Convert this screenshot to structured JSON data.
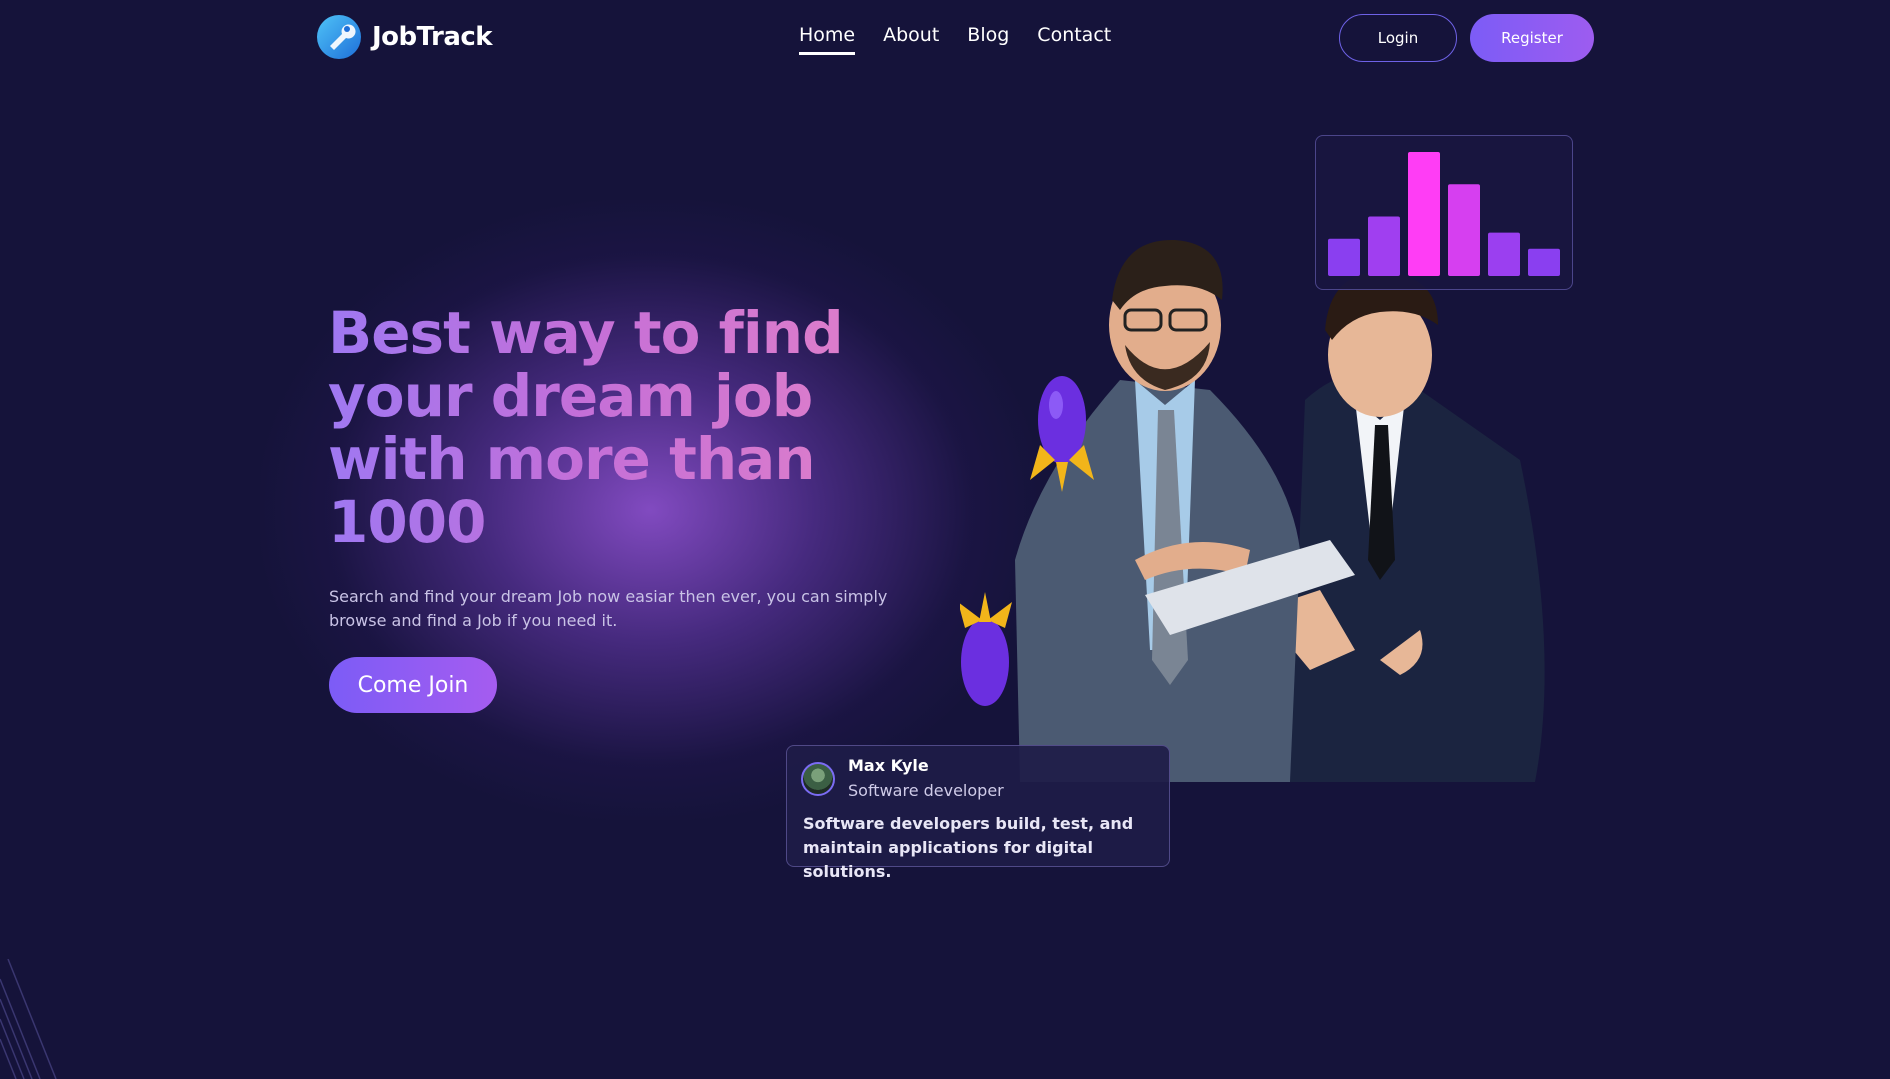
{
  "brand": {
    "name": "JobTrack",
    "icon": "wrench-logo-icon"
  },
  "nav": {
    "items": [
      {
        "label": "Home",
        "active": true
      },
      {
        "label": "About",
        "active": false
      },
      {
        "label": "Blog",
        "active": false
      },
      {
        "label": "Contact",
        "active": false
      }
    ]
  },
  "auth": {
    "login_label": "Login",
    "register_label": "Register"
  },
  "hero": {
    "title": "Best way to find your dream job with more than 1000",
    "subtitle": "Search and find your dream Job now easiar then ever, you can simply browse and find a Job if you need it.",
    "cta_label": "Come Join"
  },
  "stats_widget": {
    "bars": [
      0.3,
      0.48,
      1.0,
      0.74,
      0.35,
      0.22
    ],
    "colors": [
      "#8a3ff0",
      "#a03ff0",
      "#ff3df5",
      "#d63ff0",
      "#9b3ff0",
      "#8a3ff0"
    ]
  },
  "profile_card": {
    "name": "Max Kyle",
    "role": "Software developer",
    "description": "Software developers build, test, and maintain applications for digital solutions."
  },
  "colors": {
    "background": "#15133a",
    "accent": "#7c5cf6",
    "accent_pink": "#ff3df5"
  }
}
